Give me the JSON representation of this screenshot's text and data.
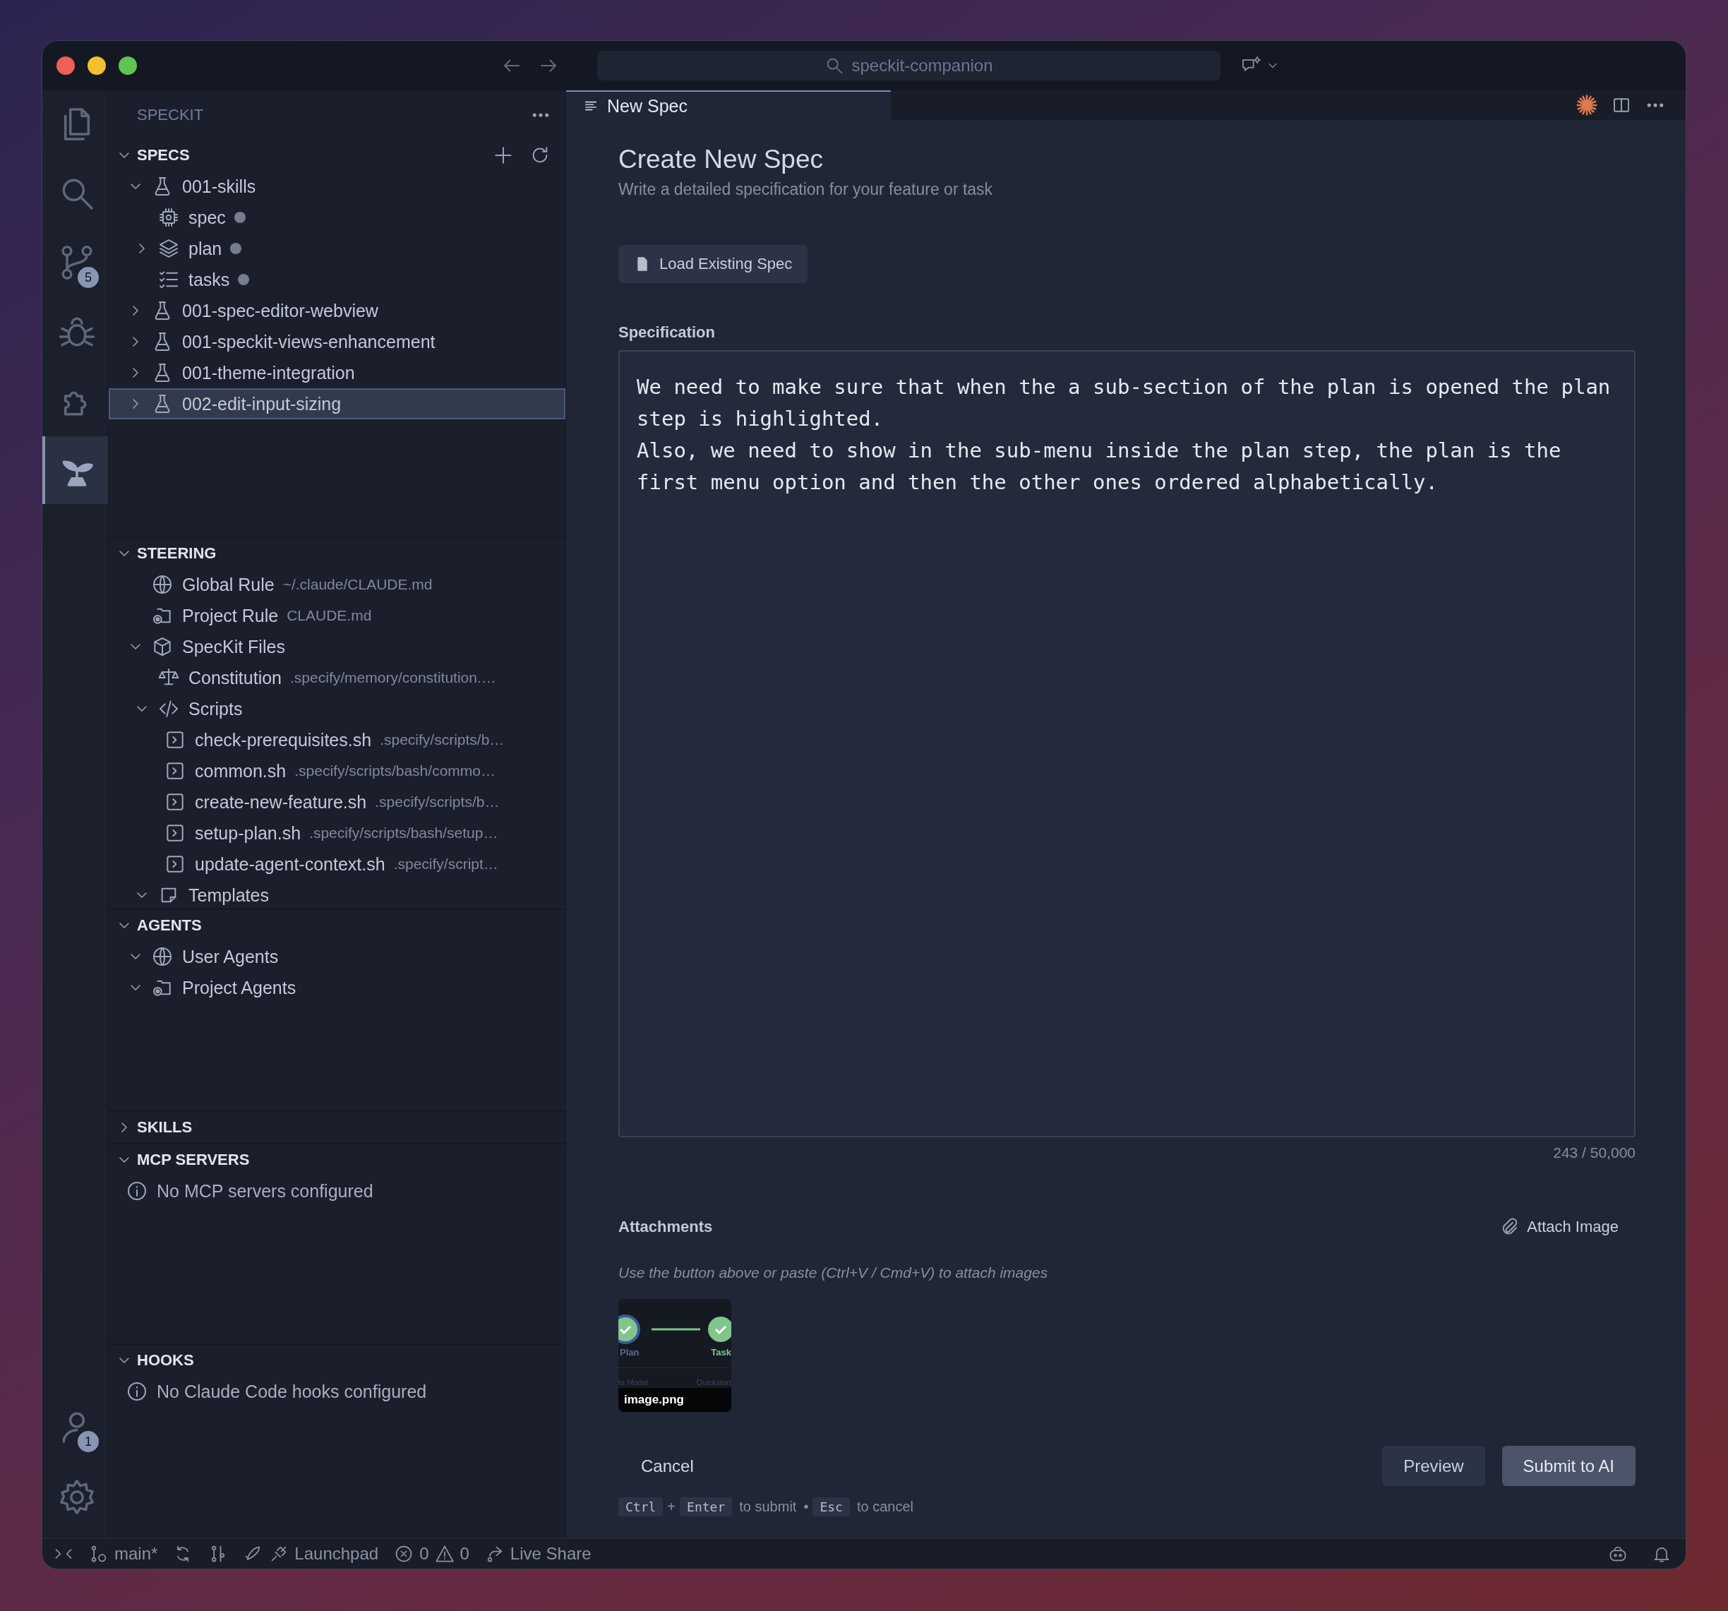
{
  "title_bar": {
    "search": "speckit-companion"
  },
  "activity_bar": {
    "top": [
      {
        "selected": false
      },
      {
        "selected": false
      },
      {
        "selected": false,
        "badge": "5"
      },
      {
        "selected": false
      },
      {
        "selected": false
      },
      {
        "selected": true
      }
    ],
    "bottom": [
      {
        "selected": false,
        "badge": "1"
      },
      {
        "selected": false
      }
    ]
  },
  "sidebar": {
    "title": "SPECKIT",
    "sections": [
      {
        "title": "SPECS",
        "expanded": true,
        "actions": true,
        "items": [
          {
            "kind": "feature",
            "label": "001-skills",
            "expanded": true,
            "selected": false,
            "children": [
              {
                "kind": "spec",
                "label": "spec",
                "modified": true,
                "selected": false
              },
              {
                "kind": "plan",
                "label": "plan",
                "modified": true,
                "expanded": false,
                "selected": false
              },
              {
                "kind": "tasks",
                "label": "tasks",
                "modified": true,
                "selected": false
              }
            ]
          },
          {
            "kind": "feature",
            "label": "001-spec-editor-webview",
            "expanded": false,
            "selected": false
          },
          {
            "kind": "feature",
            "label": "001-speckit-views-enhancement",
            "expanded": false,
            "selected": false
          },
          {
            "kind": "feature",
            "label": "001-theme-integration",
            "expanded": false,
            "selected": false
          },
          {
            "kind": "feature",
            "label": "002-edit-input-sizing",
            "expanded": false,
            "selected": true
          }
        ]
      },
      {
        "title": "STEERING",
        "expanded": true,
        "actions": false,
        "items": [
          {
            "kind": "global",
            "label": "Global Rule",
            "detail": "~/.claude/CLAUDE.md",
            "selected": false
          },
          {
            "kind": "project",
            "label": "Project Rule",
            "detail": "CLAUDE.md",
            "selected": false
          },
          {
            "kind": "package",
            "label": "SpecKit Files",
            "expanded": true,
            "selected": false,
            "children": [
              {
                "kind": "constitution",
                "label": "Constitution",
                "detail": ".specify/memory/constitution.…",
                "selected": false
              },
              {
                "kind": "scripts",
                "label": "Scripts",
                "expanded": true,
                "selected": false,
                "children": [
                  {
                    "kind": "script",
                    "label": "check-prerequisites.sh",
                    "detail": ".specify/scripts/b…",
                    "selected": false
                  },
                  {
                    "kind": "script",
                    "label": "common.sh",
                    "detail": ".specify/scripts/bash/commo…",
                    "selected": false
                  },
                  {
                    "kind": "script",
                    "label": "create-new-feature.sh",
                    "detail": ".specify/scripts/b…",
                    "selected": false
                  },
                  {
                    "kind": "script",
                    "label": "setup-plan.sh",
                    "detail": ".specify/scripts/bash/setup…",
                    "selected": false
                  },
                  {
                    "kind": "script",
                    "label": "update-agent-context.sh",
                    "detail": ".specify/script…",
                    "selected": false
                  }
                ]
              },
              {
                "kind": "templates",
                "label": "Templates",
                "expanded": true,
                "selected": false
              }
            ]
          }
        ]
      },
      {
        "title": "AGENTS",
        "expanded": true,
        "actions": false,
        "items": [
          {
            "kind": "global",
            "label": "User Agents",
            "expanded": true,
            "selected": false
          },
          {
            "kind": "project",
            "label": "Project Agents",
            "expanded": true,
            "selected": false
          }
        ]
      },
      {
        "title": "SKILLS",
        "expanded": false,
        "actions": false
      },
      {
        "title": "MCP SERVERS",
        "expanded": true,
        "actions": false,
        "message": "No MCP servers configured"
      },
      {
        "title": "HOOKS",
        "expanded": true,
        "actions": false,
        "message": "No Claude Code hooks configured"
      }
    ]
  },
  "editor": {
    "tabs": [
      {
        "label": "New Spec",
        "selected": true
      }
    ],
    "title": "Create New Spec",
    "subtitle": "Write a detailed specification for your feature or task",
    "load_button": "Load Existing Spec",
    "spec_label": "Specification",
    "spec_value": "We need to make sure that when the a sub-section of the plan is opened the plan step is highlighted.\nAlso, we need to show in the sub-menu inside the plan step, the plan is the first menu option and then the other ones ordered alphabetically.",
    "counter": "243 / 50,000",
    "attachments_label": "Attachments",
    "attach_button": "Attach Image",
    "hint": "Use the button above or paste (Ctrl+V / Cmd+V) to attach images",
    "attachments": [
      {
        "filename": "image.png",
        "steps": [
          "Plan",
          "Task"
        ],
        "tabs": [
          "ta Model",
          "Quickstart"
        ]
      }
    ],
    "cancel": "Cancel",
    "preview": "Preview",
    "submit": "Submit to AI",
    "shortcuts": [
      {
        "kind": "key",
        "text": "Ctrl"
      },
      {
        "kind": "plus",
        "text": "+"
      },
      {
        "kind": "key",
        "text": "Enter"
      },
      {
        "kind": "text",
        "text": "to submit"
      },
      {
        "kind": "sep",
        "text": "•"
      },
      {
        "kind": "key",
        "text": "Esc"
      },
      {
        "kind": "text",
        "text": "to cancel"
      }
    ]
  },
  "status_bar": {
    "branch": "main*",
    "launchpad": "Launchpad",
    "errors": "0",
    "warnings": "0",
    "live_share": "Live Share"
  }
}
